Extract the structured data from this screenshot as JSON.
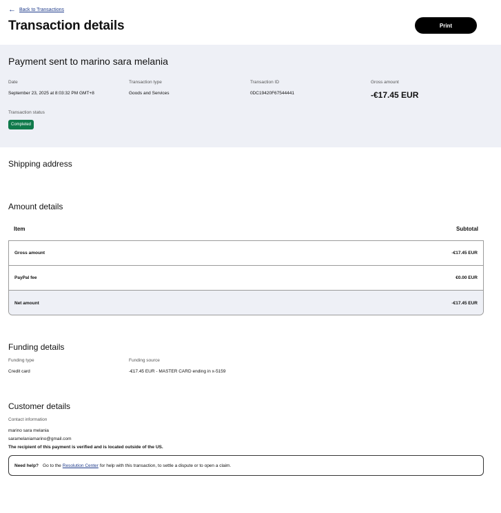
{
  "nav": {
    "back_label": "Back to Transactions"
  },
  "header": {
    "title": "Transaction details",
    "print_label": "Print"
  },
  "summary": {
    "title": "Payment sent to marino sara melania",
    "date_label": "Date",
    "date_value": "September 23, 2025 at 8:03:32 PM GMT+8",
    "type_label": "Transaction type",
    "type_value": "Goods and Services",
    "id_label": "Transaction ID",
    "id_value": "0DC19420F67544441",
    "gross_label": "Gross amount",
    "gross_value": "-€17.45 EUR",
    "status_label": "Transaction status",
    "status_value": "Completed"
  },
  "shipping": {
    "heading": "Shipping address"
  },
  "amount": {
    "heading": "Amount details",
    "col_item": "Item",
    "col_subtotal": "Subtotal",
    "rows": [
      {
        "label": "Gross amount",
        "value": "-€17.45 EUR"
      },
      {
        "label": "PayPal fee",
        "value": "€0.00 EUR"
      },
      {
        "label": "Net amount",
        "value": "-€17.45 EUR"
      }
    ]
  },
  "funding": {
    "heading": "Funding details",
    "type_label": "Funding type",
    "type_value": "Credit card",
    "source_label": "Funding source",
    "source_value": "-€17.45 EUR - MASTER CARD ending in x-5159"
  },
  "customer": {
    "heading": "Customer details",
    "contact_label": "Contact information",
    "name": "marino sara melania",
    "email": "saramelaniamarino@gmail.com",
    "verified_note": "The recipient of this payment is verified and is located outside of the US."
  },
  "help": {
    "title": "Need help?",
    "prefix": "Go to the",
    "link": "Resolution Center",
    "suffix": "for help with this transaction, to settle a dispute or to open a claim."
  },
  "colors": {
    "status_green": "#0f7a4b",
    "summary_bg": "#eef0f6",
    "link_blue": "#1d3a8a"
  }
}
